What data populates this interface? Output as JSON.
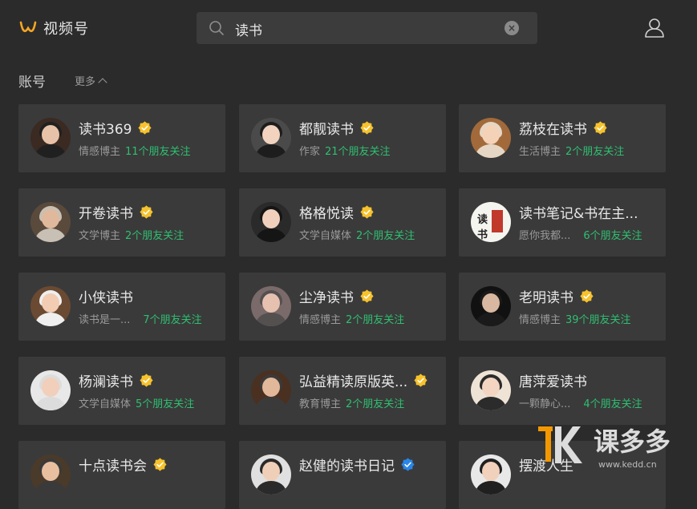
{
  "header": {
    "app_name": "视频号",
    "search": {
      "value": "读书",
      "placeholder": ""
    },
    "clear_icon": "x-circle-icon",
    "user_icon": "user-icon"
  },
  "section": {
    "title": "账号",
    "more_label": "更多"
  },
  "colors": {
    "background": "#2b2b2b",
    "card": "#3a3a3a",
    "friends_green": "#2fbf71",
    "badge_gold": "#f6c22d",
    "badge_blue": "#2a86e8"
  },
  "accounts": [
    {
      "name": "读书369",
      "role": "情感博主",
      "friends": "11个朋友关注",
      "badge": "gold"
    },
    {
      "name": "都靓读书",
      "role": "作家",
      "friends": "21个朋友关注",
      "badge": "gold"
    },
    {
      "name": "荔枝在读书",
      "role": "生活博主",
      "friends": "2个朋友关注",
      "badge": "gold"
    },
    {
      "name": "开卷读书",
      "role": "文学博主",
      "friends": "2个朋友关注",
      "badge": "gold"
    },
    {
      "name": "格格悦读",
      "role": "文学自媒体",
      "friends": "2个朋友关注",
      "badge": "gold"
    },
    {
      "name": "读书笔记&书在主...",
      "role": "愿你我都...",
      "friends": "6个朋友关注",
      "badge": "none"
    },
    {
      "name": "小侠读书",
      "role": "读书是一...",
      "friends": "7个朋友关注",
      "badge": "none"
    },
    {
      "name": "尘净读书",
      "role": "情感博主",
      "friends": "2个朋友关注",
      "badge": "gold"
    },
    {
      "name": "老明读书",
      "role": "情感博主",
      "friends": "39个朋友关注",
      "badge": "gold"
    },
    {
      "name": "杨澜读书",
      "role": "文学自媒体",
      "friends": "5个朋友关注",
      "badge": "gold"
    },
    {
      "name": "弘益精读原版英...",
      "role": "教育博主",
      "friends": "2个朋友关注",
      "badge": "gold"
    },
    {
      "name": "唐萍爱读书",
      "role": "一颗静心...",
      "friends": "4个朋友关注",
      "badge": "none"
    },
    {
      "name": "十点读书会",
      "role": "",
      "friends": "",
      "badge": "gold"
    },
    {
      "name": "赵健的读书日记",
      "role": "",
      "friends": "",
      "badge": "blue"
    },
    {
      "name": "摆渡人生",
      "role": "",
      "friends": "",
      "badge": "none"
    }
  ],
  "watermark": {
    "text": "课多多",
    "url": "www.kedd.cn"
  }
}
